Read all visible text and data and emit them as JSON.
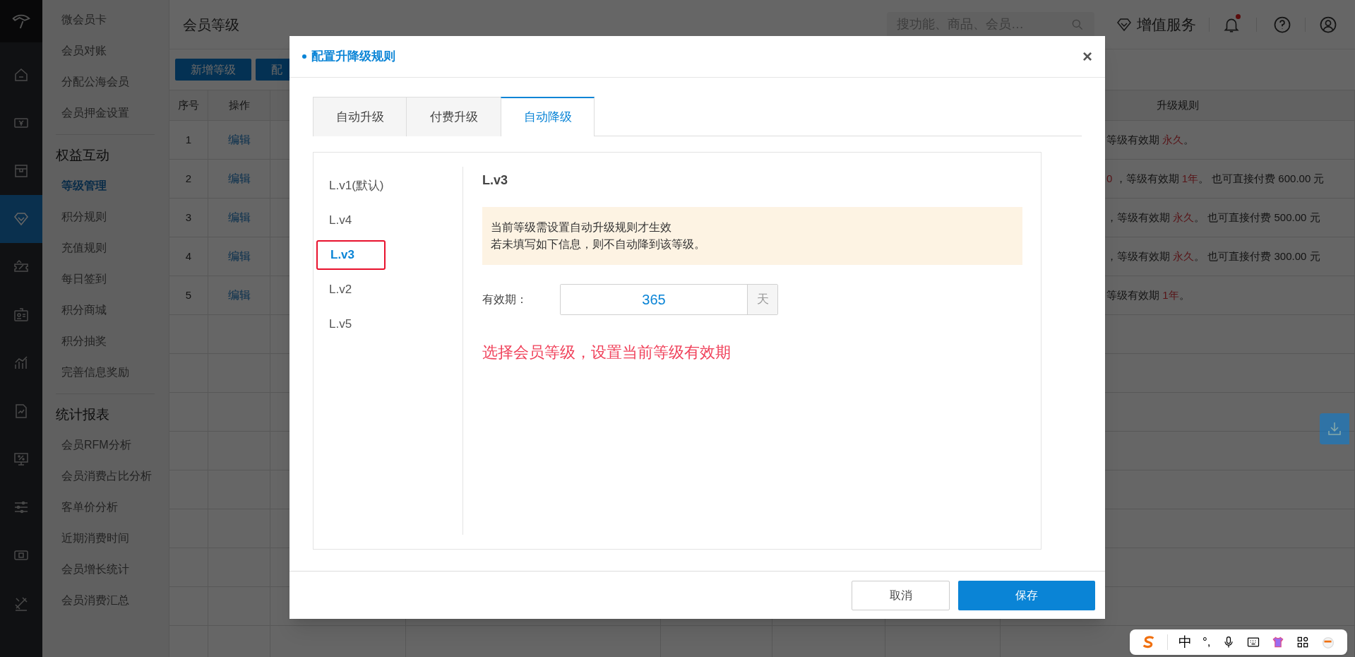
{
  "nav_rail": {
    "items": [
      {
        "kind": "home",
        "selected": false
      },
      {
        "kind": "money",
        "selected": false
      },
      {
        "kind": "box",
        "selected": false
      },
      {
        "kind": "diamond",
        "selected": true
      },
      {
        "kind": "ticket",
        "selected": false
      },
      {
        "kind": "card",
        "selected": false
      },
      {
        "kind": "chart",
        "selected": false
      },
      {
        "kind": "report",
        "selected": false
      },
      {
        "kind": "screen",
        "selected": false
      },
      {
        "kind": "sliders",
        "selected": false
      },
      {
        "kind": "device",
        "selected": false
      },
      {
        "kind": "tools",
        "selected": false
      }
    ]
  },
  "submenu": [
    {
      "items": [
        {
          "label": "微会员卡",
          "selected": false
        },
        {
          "label": "会员对账",
          "selected": false
        },
        {
          "label": "分配公海会员",
          "selected": false
        },
        {
          "label": "会员押金设置",
          "selected": false
        }
      ]
    },
    {
      "title": "权益互动",
      "items": [
        {
          "label": "等级管理",
          "selected": true
        },
        {
          "label": "积分规则",
          "selected": false
        },
        {
          "label": "充值规则",
          "selected": false
        },
        {
          "label": "每日签到",
          "selected": false
        },
        {
          "label": "积分商城",
          "selected": false
        },
        {
          "label": "积分抽奖",
          "selected": false
        },
        {
          "label": "完善信息奖励",
          "selected": false
        }
      ]
    },
    {
      "title": "统计报表",
      "items": [
        {
          "label": "会员RFM分析",
          "selected": false
        },
        {
          "label": "会员消费占比分析",
          "selected": false
        },
        {
          "label": "客单价分析",
          "selected": false
        },
        {
          "label": "近期消费时间",
          "selected": false
        },
        {
          "label": "会员增长统计",
          "selected": false
        },
        {
          "label": "会员消费汇总",
          "selected": false
        }
      ]
    }
  ],
  "header": {
    "title": "会员等级",
    "search": {
      "placeholder": "搜功能、商品、会员…"
    },
    "service_label": "增值服务",
    "notification_dot": true
  },
  "toolbar": {
    "buttons": [
      "新增等级",
      "配"
    ]
  },
  "table": {
    "columns": [
      {
        "kind": "index",
        "label": "序号"
      },
      {
        "kind": "action",
        "label": "操作"
      },
      {
        "kind": "rule",
        "label": "升级规则"
      }
    ],
    "rows": [
      {
        "index": "1",
        "action": "编辑",
        "rule": [
          {
            "text": "等级有效期 ",
            "highlight": false
          },
          {
            "text": "永久",
            "highlight": true
          },
          {
            "text": "。",
            "highlight": false
          }
        ]
      },
      {
        "index": "2",
        "action": "编辑",
        "rule": [
          {
            "text": "0",
            "highlight": true
          },
          {
            "text": " ，等级有效期 ",
            "highlight": false
          },
          {
            "text": "1年",
            "highlight": true
          },
          {
            "text": "。 也可直接付费 600.00 元",
            "highlight": false
          }
        ]
      },
      {
        "index": "3",
        "action": "编辑",
        "rule": [
          {
            "text": "，等级有效期 ",
            "highlight": false
          },
          {
            "text": "永久",
            "highlight": true
          },
          {
            "text": "。 也可直接付费 500.00 元",
            "highlight": false
          }
        ]
      },
      {
        "index": "4",
        "action": "编辑",
        "rule": [
          {
            "text": "，等级有效期 ",
            "highlight": false
          },
          {
            "text": "永久",
            "highlight": true
          },
          {
            "text": "。 也可直接付费 300.00 元",
            "highlight": false
          }
        ]
      },
      {
        "index": "5",
        "action": "编辑",
        "rule": [
          {
            "text": "等级有效期 ",
            "highlight": false
          },
          {
            "text": "1年",
            "highlight": true
          },
          {
            "text": "。",
            "highlight": false
          }
        ]
      }
    ]
  },
  "modal": {
    "title": "配置升降级规则",
    "close": "×",
    "tabs": [
      {
        "label": "自动升级",
        "selected": false
      },
      {
        "label": "付费升级",
        "selected": false
      },
      {
        "label": "自动降级",
        "selected": true
      }
    ],
    "levels": [
      {
        "label": "L.v1(默认)",
        "selected": false
      },
      {
        "label": "L.v4",
        "selected": false
      },
      {
        "label": "L.v3",
        "selected": true
      },
      {
        "label": "L.v2",
        "selected": false
      },
      {
        "label": "L.v5",
        "selected": false
      }
    ],
    "detail": {
      "title": "L.v3",
      "notice": [
        "当前等级需设置自动升级规则才生效",
        "若未填写如下信息，则不自动降到该等级。"
      ],
      "validity": {
        "label": "有效期：",
        "value": "365",
        "unit": "天"
      },
      "annotation": "选择会员等级，设置当前等级有效期"
    },
    "buttons": {
      "cancel": "取消",
      "save": "保存"
    }
  },
  "ime_toolbar": {
    "mode": "中",
    "punctuation": "°,"
  }
}
